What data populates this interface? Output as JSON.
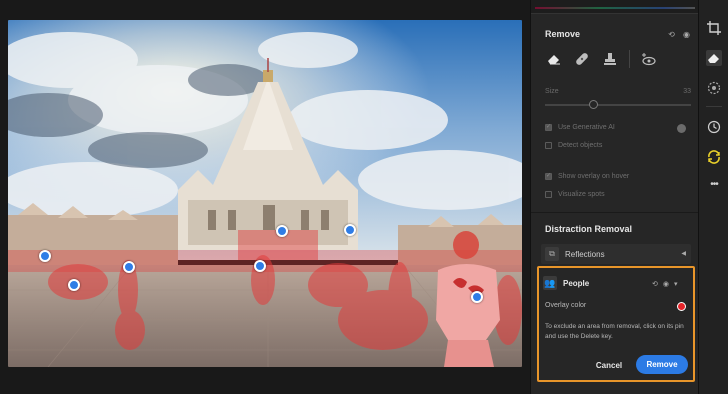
{
  "remove_panel": {
    "title": "Remove",
    "size_label": "Size",
    "size_value": "33",
    "size_fraction": 0.32,
    "use_gen_ai": "Use Generative AI",
    "use_gen_ai_checked": true,
    "detect_objects": "Detect objects",
    "detect_objects_checked": false,
    "show_overlay": "Show overlay on hover",
    "show_overlay_checked": true,
    "visualize_spots": "Visualize spots",
    "visualize_spots_checked": false,
    "tools": [
      "eraser-icon",
      "bandage-icon",
      "stamp-icon",
      "eye-plus-icon"
    ]
  },
  "distraction": {
    "title": "Distraction Removal",
    "reflections_label": "Reflections",
    "people_label": "People",
    "overlay_color_label": "Overlay color",
    "overlay_color": "#e5252a",
    "help_text": "To exclude an area from removal, click on its pin and use the Delete key.",
    "cancel_label": "Cancel",
    "remove_label": "Remove"
  },
  "toolstrip": [
    "crop-icon",
    "eraser-icon",
    "masking-icon",
    "history-icon",
    "presets-icon",
    "more-icon"
  ],
  "colors": {
    "accent": "#2c7be5",
    "highlight_border": "#e8952a",
    "pin": "#2f7de6"
  }
}
